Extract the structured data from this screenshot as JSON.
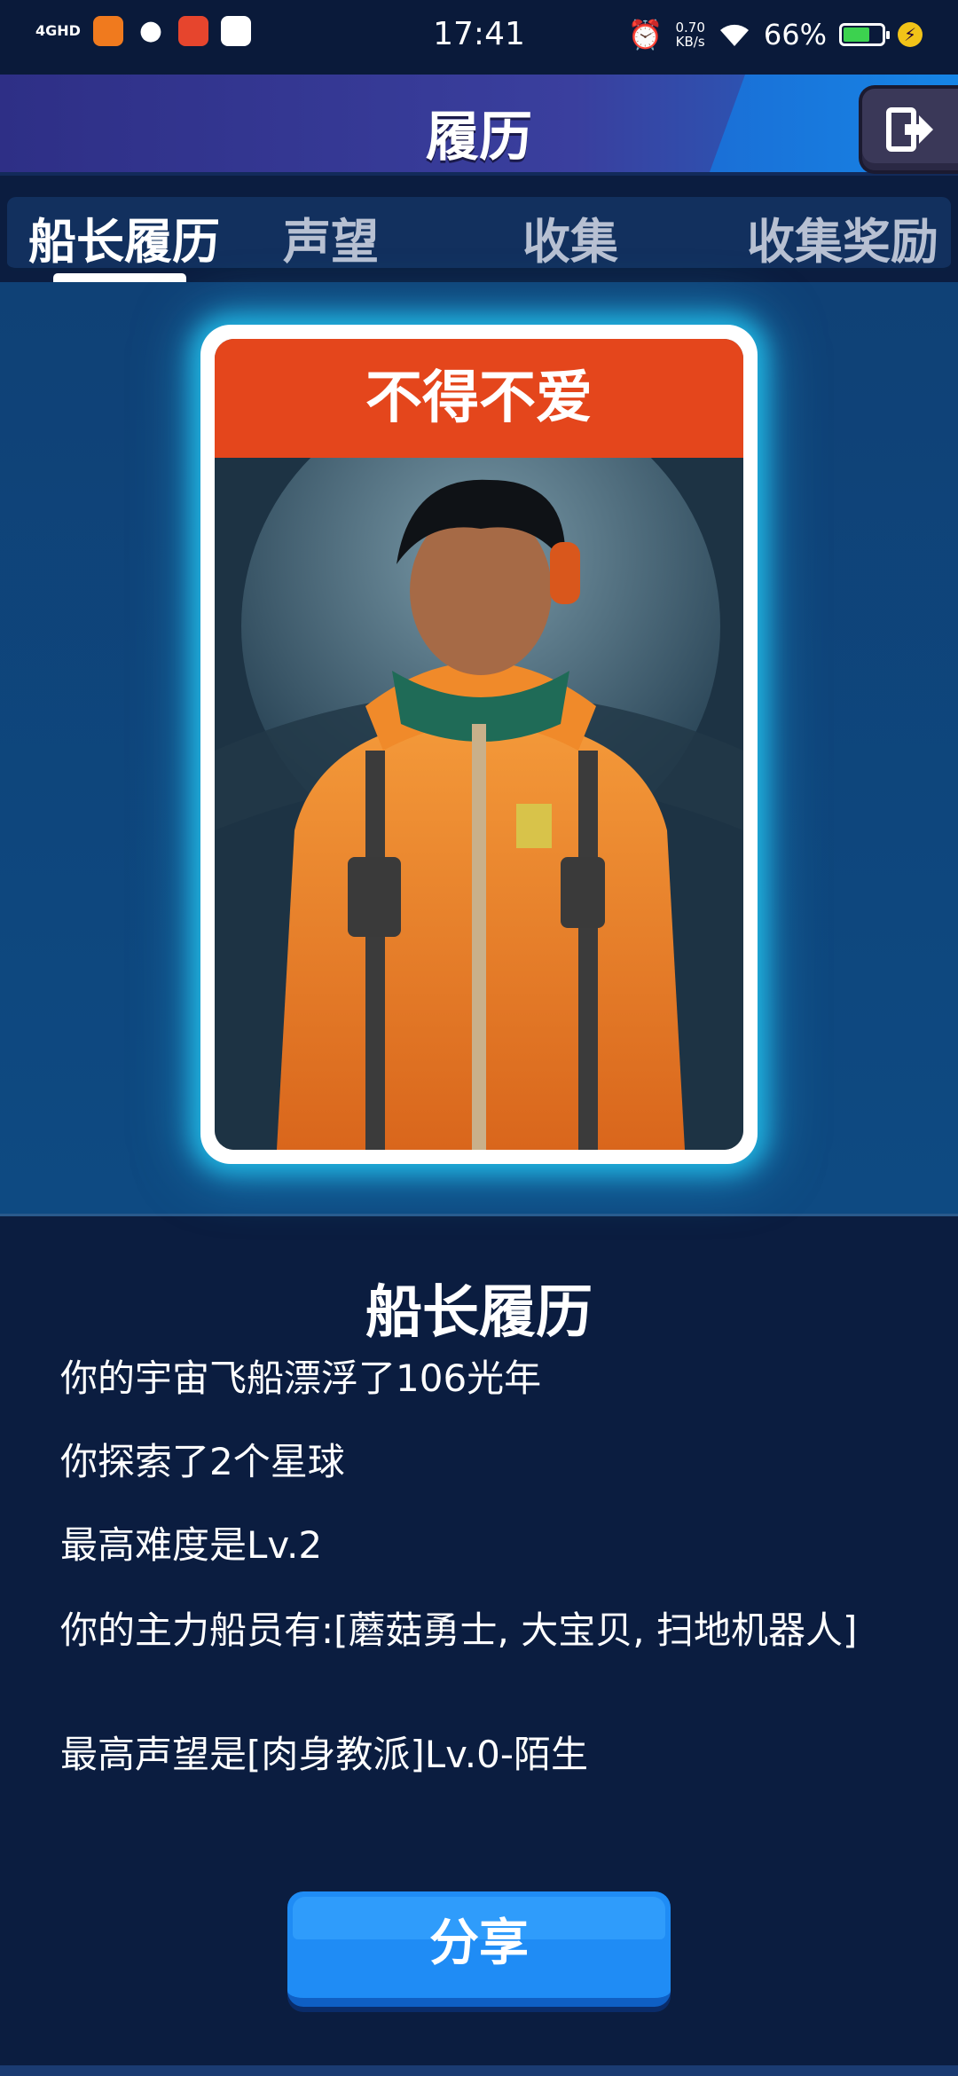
{
  "status_bar": {
    "signal": "4GHD",
    "time": "17:41",
    "speed_value": "0.70",
    "speed_unit": "KB/s",
    "battery": "66%"
  },
  "header": {
    "title": "履历"
  },
  "tabs": [
    {
      "label": "船长履历",
      "active": true
    },
    {
      "label": "声望",
      "active": false
    },
    {
      "label": "收集",
      "active": false
    },
    {
      "label": "收集奖励",
      "active": false
    }
  ],
  "card": {
    "banner": "不得不爱"
  },
  "info": {
    "title": "船长履历",
    "lines": [
      "你的宇宙飞船漂浮了106光年",
      "你探索了2个星球",
      "最高难度是Lv.2",
      "你的主力船员有:[蘑菇勇士, 大宝贝, 扫地机器人]",
      "最高声望是[肉身教派]Lv.0-陌生"
    ]
  },
  "share_button": {
    "label": "分享"
  },
  "colors": {
    "accent_blue": "#1f8cf5",
    "banner_red": "#e4461c",
    "glow_cyan": "#1fb3e0"
  }
}
